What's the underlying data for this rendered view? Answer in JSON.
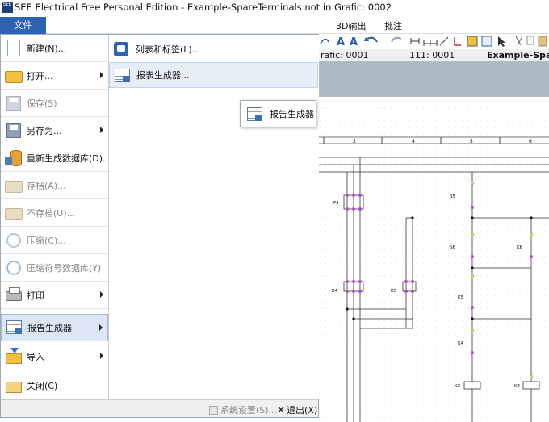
{
  "window": {
    "title": "SEE Electrical Free Personal Edition - Example-SpareTerminals not in Grafic: 0002",
    "logo_text": "SEE"
  },
  "ribbon": {
    "file_tab": "文件",
    "tabs": [
      "3D输出",
      "批注"
    ]
  },
  "page_tabs": {
    "items": [
      "rafic: 0001",
      "111: 0001",
      "Example-Spare"
    ]
  },
  "file_menu": {
    "items": [
      {
        "label": "新建(N)...",
        "icon": "new-document-icon",
        "submenu": false,
        "enabled": true
      },
      {
        "label": "打开...",
        "icon": "open-folder-icon",
        "submenu": true,
        "enabled": true
      },
      {
        "label": "保存(S)",
        "icon": "save-icon",
        "submenu": false,
        "enabled": false
      },
      {
        "label": "另存为...",
        "icon": "save-as-icon",
        "submenu": true,
        "enabled": true
      },
      {
        "label": "重新生成数据库(D)...",
        "icon": "rebuild-database-icon",
        "submenu": false,
        "enabled": true
      },
      {
        "label": "存档(A)...",
        "icon": "archive-icon",
        "submenu": false,
        "enabled": false
      },
      {
        "label": "不存档(U)...",
        "icon": "unarchive-icon",
        "submenu": false,
        "enabled": false
      },
      {
        "label": "压缩(C)...",
        "icon": "compress-icon",
        "submenu": false,
        "enabled": false
      },
      {
        "label": "压缩符号数据库(Y)",
        "icon": "compress-symbol-db-icon",
        "submenu": false,
        "enabled": false
      },
      {
        "label": "打印",
        "icon": "printer-icon",
        "submenu": true,
        "enabled": true
      },
      {
        "label": "报告生成器",
        "icon": "report-generator-icon",
        "submenu": true,
        "enabled": true,
        "active": true
      },
      {
        "label": "导入",
        "icon": "import-icon",
        "submenu": true,
        "enabled": true
      },
      {
        "label": "关闭(C)",
        "icon": "close-folder-icon",
        "submenu": false,
        "enabled": true
      }
    ],
    "submenu": [
      {
        "label": "列表和标签(L)...",
        "icon": "list-labels-icon"
      },
      {
        "label": "报表生成器...",
        "icon": "report-builder-icon"
      }
    ],
    "footer": {
      "settings": "系统设置(S)...",
      "exit": "退出(X)"
    }
  },
  "tooltip": {
    "label": "报告生成器",
    "icon": "report-generator-icon"
  },
  "schematic": {
    "column_numbers": [
      "3",
      "4",
      "5",
      "6"
    ],
    "labels": [
      "F3",
      "S5",
      "S6",
      "K6",
      "K4",
      "K5",
      "K5",
      "K4",
      "K3",
      "K4"
    ]
  }
}
